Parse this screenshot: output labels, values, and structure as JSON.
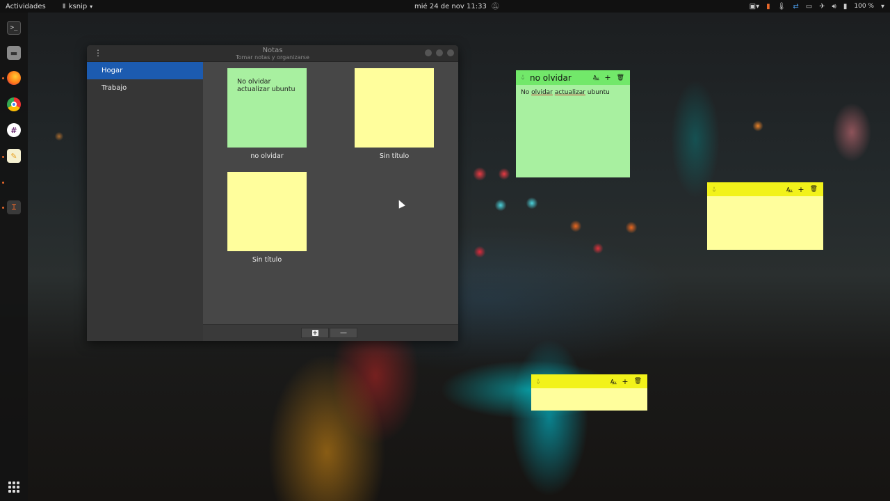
{
  "topbar": {
    "activities": "Actividades",
    "app_name": "ksnip",
    "clock": "mié 24 de nov  11:33",
    "battery": "100 %"
  },
  "dock": {
    "icons": [
      "terminal-icon",
      "files-icon",
      "firefox-icon",
      "chrome-icon",
      "slack-icon",
      "text-editor-icon",
      "ksnip-icon"
    ]
  },
  "window": {
    "title": "Notas",
    "subtitle": "Tomar notas y organizarse",
    "sidebar": [
      {
        "label": "Hogar",
        "active": true
      },
      {
        "label": "Trabajo",
        "active": false
      }
    ],
    "notes": [
      {
        "label": "no olvidar",
        "text": "No olvidar actualizar ubuntu",
        "color": "#a8f0a0"
      },
      {
        "label": "Sin título",
        "text": "",
        "color": "#fffe9c"
      },
      {
        "label": "Sin título",
        "text": "",
        "color": "#fffe9c"
      }
    ],
    "bottom_buttons": {
      "add": "+",
      "remove": "—"
    }
  },
  "stickies": [
    {
      "title": "no olvidar",
      "body_words": [
        "No",
        "olvidar",
        "actualizar",
        "ubuntu"
      ],
      "header_color": "#72e86a",
      "body_color": "#a8f0a0"
    },
    {
      "title": "",
      "body": "",
      "header_color": "#f2f21a",
      "body_color": "#fffe9c"
    },
    {
      "title": "",
      "body": "",
      "header_color": "#f2f21a",
      "body_color": "#fffe9c"
    }
  ]
}
